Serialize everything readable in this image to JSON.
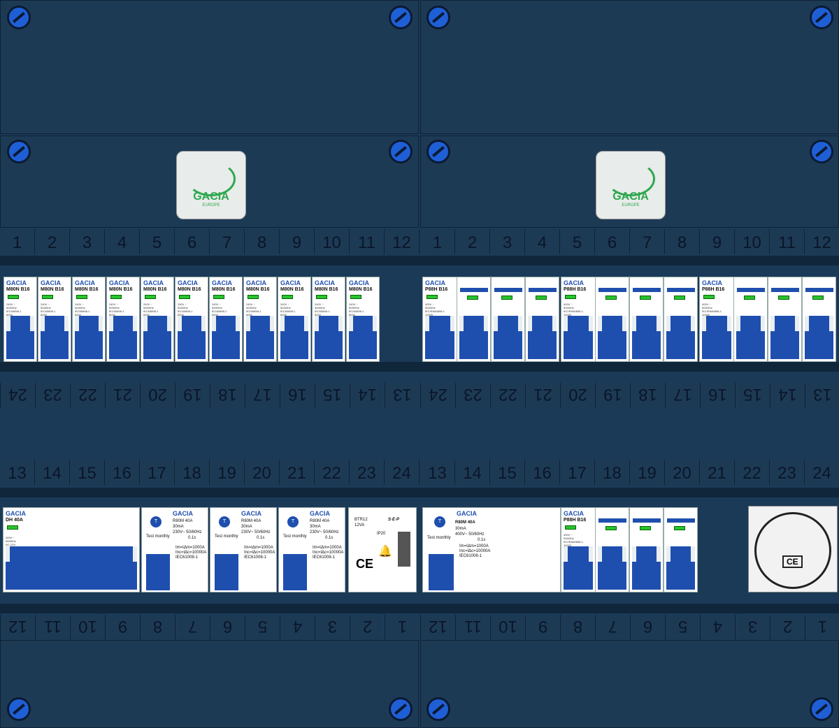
{
  "row_numbers": {
    "top": [
      "1",
      "2",
      "3",
      "4",
      "5",
      "6",
      "7",
      "8",
      "9",
      "10",
      "11",
      "12"
    ],
    "bottom": [
      "13",
      "14",
      "15",
      "16",
      "17",
      "18",
      "19",
      "20",
      "21",
      "22",
      "23",
      "24"
    ]
  },
  "logo": {
    "brand": "GACIA",
    "sub": "EUROPE"
  },
  "left_row1": {
    "brand": "GACIA",
    "model": "M80N",
    "rating": "B16",
    "spec_lines": [
      "240V ~",
      "50/60Hz",
      "IEC60898-1",
      "6000"
    ]
  },
  "right_row1": {
    "brand": "GACIA",
    "model": "P88H",
    "rating": "B16",
    "spec_lines": [
      "400V ~",
      "50/60Hz",
      "IEC/EN60898-1",
      "10000"
    ]
  },
  "left_row2": {
    "main_switch": {
      "brand": "GACIA",
      "model": "DH",
      "rating": "40A",
      "spec_lines": [
        "400V~",
        "50/60Hz",
        "AC-22A",
        "IEC60947-3"
      ]
    },
    "rcbo": {
      "brand": "GACIA",
      "model": "R80M",
      "rating": "40A",
      "sens": "30mA",
      "volt": "230V~",
      "freq": "50/60Hz",
      "time": "0.1s",
      "test": "Test monthly",
      "im": "Im=IΔm=1000A",
      "inc": "Inc=IΔc=10000A",
      "std": "IEC61008-1"
    },
    "bell": {
      "model": "BTR12",
      "va": "12VA",
      "ip": "IP20",
      "brand": "S·E·P"
    }
  },
  "right_row2": {
    "rcd": {
      "brand": "GACIA",
      "model": "R80M",
      "rating": "40A",
      "sens": "30mA",
      "volt": "400V~",
      "freq": "50/60Hz",
      "time": "0.1s",
      "test": "Test monthly",
      "im": "Im=IΔm=1000A",
      "inc": "Inc=IΔc=10000A",
      "std": "IEC61008-1"
    },
    "mcb": {
      "brand": "GACIA",
      "model": "P88H",
      "rating": "B16",
      "spec_lines": [
        "400V ~",
        "50/60Hz",
        "IEC/EN60898-1",
        "10000"
      ]
    },
    "socket_mark": "CE"
  },
  "colors": {
    "panel": "#1d3a55",
    "accent": "#1f4fae",
    "indicator": "#29c42f",
    "screw": "#1f5fd6"
  }
}
